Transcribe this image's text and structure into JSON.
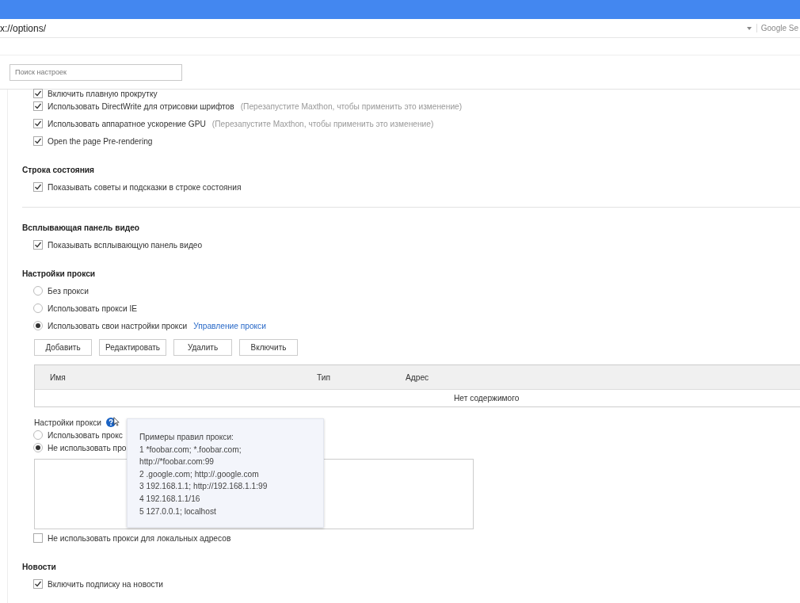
{
  "address_bar": {
    "url": "x://options/",
    "search_engine": "Google Se"
  },
  "search": {
    "placeholder": "Поиск настроек"
  },
  "sections": [
    {
      "kind": "checks",
      "items": [
        {
          "label": "Включить плавную прокрутку",
          "checked": true
        },
        {
          "label": "Использовать DirectWrite для отрисовки шрифтов",
          "note": "(Перезапустите Maxthon, чтобы применить это изменение)",
          "checked": true
        },
        {
          "label": "Использовать аппаратное ускорение GPU",
          "note": "(Перезапустите Maxthon, чтобы применить это изменение)",
          "checked": true
        },
        {
          "label": "Open the page Pre-rendering",
          "checked": true
        }
      ]
    },
    {
      "kind": "checks",
      "title": "Строка состояния",
      "divider": true,
      "items": [
        {
          "label": "Показывать советы и подсказки в строке состояния",
          "checked": true
        }
      ]
    },
    {
      "kind": "checks",
      "title": "Всплывающая панель видео",
      "items": [
        {
          "label": "Показывать всплывающую панель видео",
          "checked": true
        }
      ]
    }
  ],
  "proxy": {
    "title": "Настройки прокси",
    "modes": [
      {
        "label": "Без прокси",
        "selected": false
      },
      {
        "label": "Использовать прокси IE",
        "selected": false
      },
      {
        "label": "Использовать свои настройки прокси",
        "link": "Управление прокси",
        "selected": true
      }
    ],
    "buttons": [
      "Добавить",
      "Редактировать",
      "Удалить",
      "Включить"
    ],
    "table": {
      "columns": [
        "Имя",
        "Тип",
        "Адрес"
      ],
      "empty": "Нет содержимого"
    },
    "rules_label": "Настройки прокси",
    "rules_modes": [
      {
        "label": "Использовать прокс",
        "selected": false
      },
      {
        "label": "Не использовать про",
        "selected": true
      }
    ],
    "local": {
      "label": "Не использовать прокси для локальных адресов",
      "checked": false
    },
    "tooltip": {
      "title": "Примеры правил прокси:",
      "lines": [
        "1 *foobar.com; *.foobar.com;",
        "http://*foobar.com:99",
        "2 .google.com; http://.google.com",
        "3 192.168.1.1; http://192.168.1.1:99",
        "4 192.168.1.1/16",
        "5 127.0.0.1; localhost"
      ]
    }
  },
  "news": {
    "title": "Новости",
    "items": [
      {
        "label": "Включить подписку на новости",
        "checked": true
      }
    ]
  }
}
